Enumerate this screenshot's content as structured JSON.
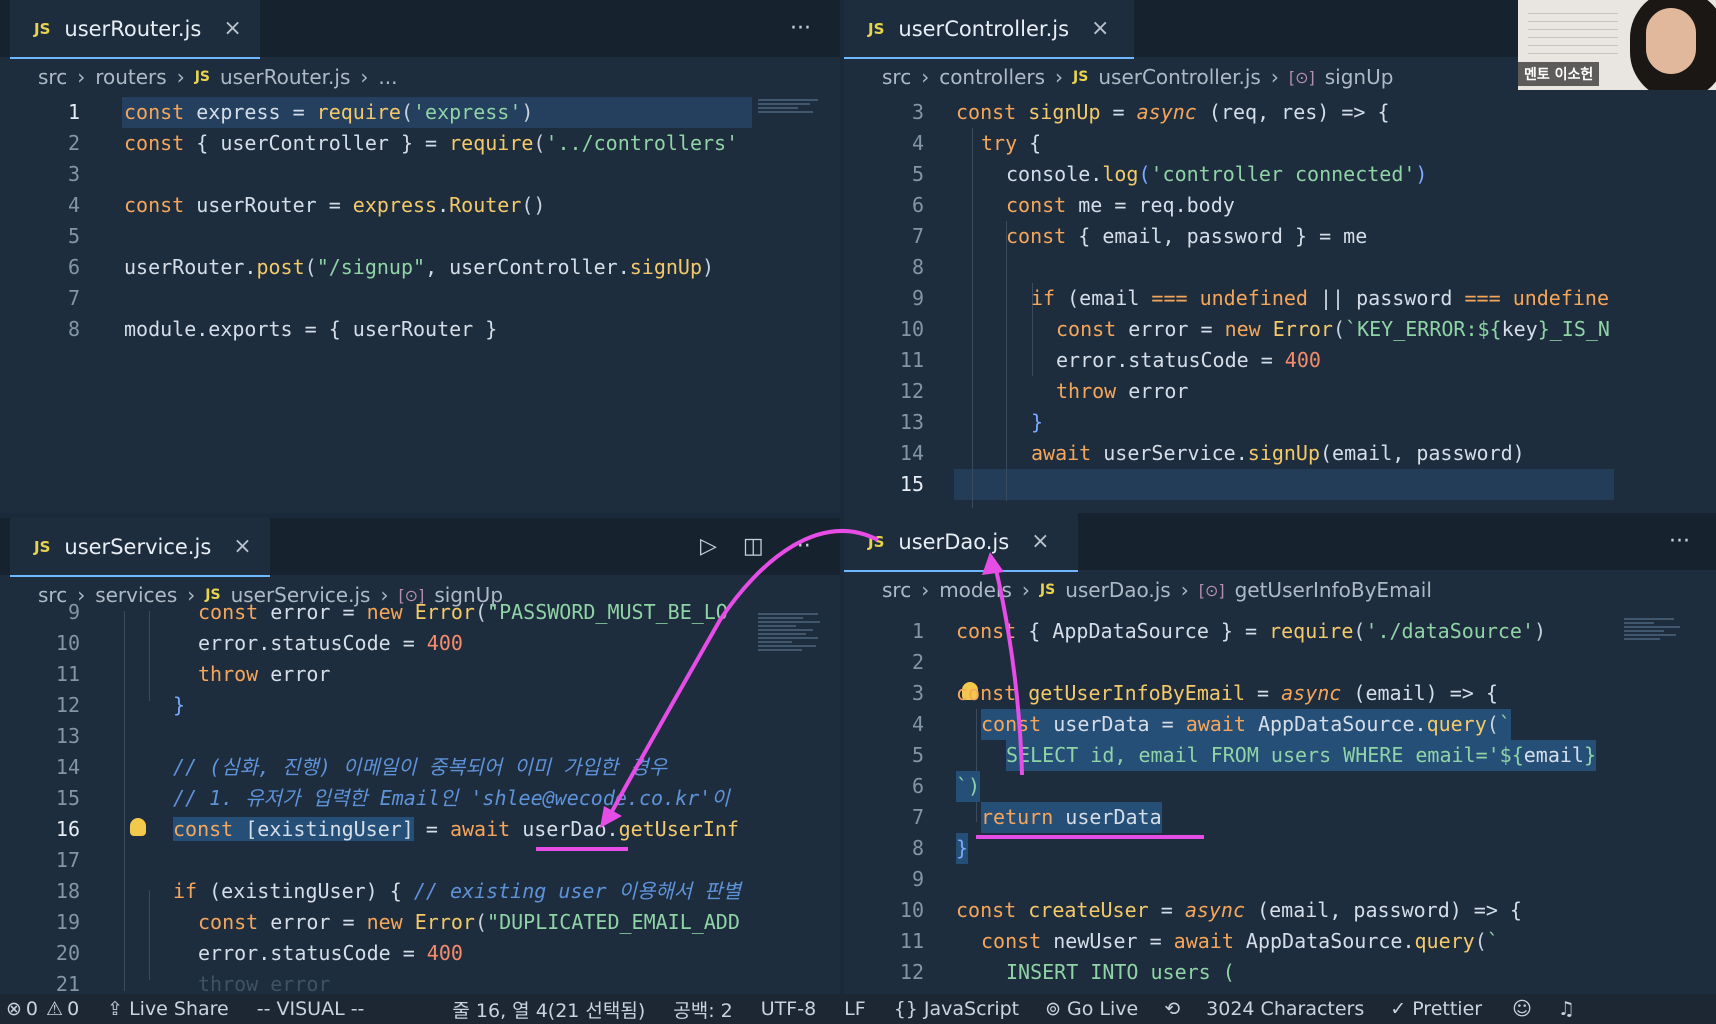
{
  "left_top": {
    "tab": "userRouter.js",
    "breadcrumb": {
      "p1": "src",
      "p2": "routers",
      "file": "userRouter.js",
      "rest": "..."
    },
    "more": "···"
  },
  "right_top": {
    "tab": "userController.js",
    "breadcrumb": {
      "p1": "src",
      "p2": "controllers",
      "file": "userController.js",
      "symbol": "signUp"
    }
  },
  "left_bottom": {
    "tab": "userService.js",
    "breadcrumb": {
      "p1": "src",
      "p2": "services",
      "file": "userService.js",
      "symbol": "signUp"
    },
    "more": "···"
  },
  "right_bottom": {
    "tab": "userDao.js",
    "breadcrumb": {
      "p1": "src",
      "p2": "models",
      "file": "userDao.js",
      "symbol": "getUserInfoByEmail"
    },
    "more": "···"
  },
  "webcam_label": "멘토 이소헌",
  "status": {
    "errors": "0",
    "warnings": "0",
    "live_share": "Live Share",
    "mode": "-- VISUAL --",
    "position": "줄 16, 열 4(21 선택됨)",
    "spaces": "공백: 2",
    "encoding": "UTF-8",
    "eol": "LF",
    "language": "JavaScript",
    "go_live": "Go Live",
    "characters": "3024 Characters",
    "prettier": "Prettier"
  },
  "icons": [
    "close-icon",
    "more-icon",
    "run-icon",
    "split-editor-icon",
    "symbol-icon",
    "lightbulb-icon",
    "error-icon",
    "warning-icon",
    "live-share-icon",
    "braces-icon",
    "broadcast-icon",
    "bell-icon",
    "account-icon"
  ],
  "colors": {
    "accent_annotation": "#e64ce6",
    "keyword": "#f5a65b",
    "string": "#8fd3a6",
    "comment": "#5e92d9"
  },
  "code": {
    "router": {
      "numbers": [
        "1",
        "2",
        "3",
        "4",
        "5",
        "6",
        "7",
        "8"
      ],
      "l1": [
        "const",
        " express = ",
        "require",
        "(",
        "'express'",
        ")"
      ],
      "l2": [
        "const",
        " { userController } = ",
        "require",
        "(",
        "'../controllers'"
      ],
      "l4": [
        "const",
        " userRouter = ",
        "express",
        ".",
        "Router",
        "()"
      ],
      "l6": [
        "userRouter",
        ".",
        "post",
        "(",
        "\"/signup\"",
        ", userController.",
        "signUp",
        ")"
      ],
      "l8": [
        "module",
        ".exports = { userRouter }"
      ]
    },
    "controller": {
      "numbers": [
        "3",
        "4",
        "5",
        "6",
        "7",
        "8",
        "9",
        "10",
        "11",
        "12",
        "13",
        "14",
        "15"
      ],
      "l3": [
        "const",
        " ",
        "signUp",
        " = ",
        "async",
        " (req, res) => {"
      ],
      "l4": [
        "try",
        " {"
      ],
      "l5": [
        "console.",
        "log",
        "(",
        "'controller connected'",
        ")"
      ],
      "l6": [
        "const",
        " me = req.body"
      ],
      "l7": [
        "const",
        " { email, password } = me"
      ],
      "l9": [
        "if",
        " (email ",
        "===",
        " ",
        "undefined",
        " || password ",
        "===",
        " ",
        "undefine"
      ],
      "l10": [
        "const",
        " error = ",
        "new",
        " ",
        "Error",
        "(",
        "`KEY_ERROR:${",
        "key",
        "}_IS_N"
      ],
      "l11": [
        "error.statusCode = ",
        "400"
      ],
      "l12": [
        "throw",
        " error"
      ],
      "l13": [
        "}"
      ],
      "l14": [
        "await",
        " userService.",
        "signUp",
        "(email, password)"
      ]
    },
    "service": {
      "numbers": [
        "9",
        "10",
        "11",
        "12",
        "13",
        "14",
        "15",
        "16",
        "17",
        "18",
        "19",
        "20",
        "21"
      ],
      "l9": [
        "const",
        " error = ",
        "new",
        " ",
        "Error",
        "(",
        "\"PASSWORD_MUST_BE_LO"
      ],
      "l10": [
        "error.statusCode = ",
        "400"
      ],
      "l11": [
        "throw",
        " error"
      ],
      "l12": [
        "}"
      ],
      "l14": "// (심화, 진행) 이메일이 중복되어 이미 가입한 경우",
      "l15": "// 1. 유저가 입력한 Email인 'shlee@wecode.co.kr'이",
      "l16": [
        "const",
        " [existingUser]",
        " = ",
        "await",
        " userDao.",
        "getUserInf"
      ],
      "l18": [
        "if",
        " (existingUser) { ",
        "// existing user 이용해서 판별"
      ],
      "l19": [
        "const",
        " error = ",
        "new",
        " ",
        "Error",
        "(",
        "\"DUPLICATED_EMAIL_ADD"
      ],
      "l20": [
        "error.statusCode = ",
        "400"
      ],
      "l21": "throw error"
    },
    "dao": {
      "numbers": [
        "1",
        "2",
        "3",
        "4",
        "5",
        "6",
        "7",
        "8",
        "9",
        "10",
        "11",
        "12"
      ],
      "l1": [
        "const",
        " { AppDataSource } = ",
        "require",
        "(",
        "'./dataSource'",
        ")"
      ],
      "l3": [
        "const",
        " ",
        "getUserInfoByEmail",
        " = ",
        "async",
        " (email) => {"
      ],
      "l4": [
        "const",
        " userData = ",
        "await",
        " AppDataSource.",
        "query",
        "(",
        "`"
      ],
      "l5": [
        "SELECT id, email FROM users WHERE email='${",
        "email",
        "}"
      ],
      "l6": "`)",
      "l7": [
        "return",
        " userData"
      ],
      "l8": "}",
      "l10": [
        "const",
        " ",
        "createUser",
        " = ",
        "async",
        " (email, password) => {"
      ],
      "l11": [
        "const",
        " newUser = ",
        "await",
        " AppDataSource.",
        "query",
        "(",
        "`"
      ],
      "l12": "INSERT INTO users ("
    }
  }
}
